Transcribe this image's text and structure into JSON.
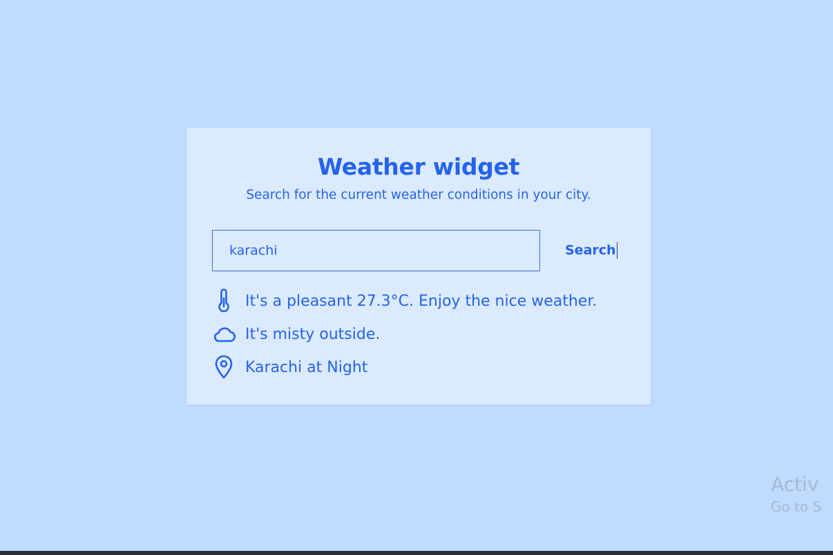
{
  "widget": {
    "title": "Weather widget",
    "subtitle": "Search for the current weather conditions in your city.",
    "search": {
      "value": "karachi",
      "placeholder": "",
      "button_label": "Search"
    },
    "results": {
      "temperature": {
        "icon": "thermometer-icon",
        "text": "It's a pleasant 27.3°C. Enjoy the nice weather."
      },
      "condition": {
        "icon": "cloud-icon",
        "text": "It's misty outside."
      },
      "location": {
        "icon": "map-pin-icon",
        "text": "Karachi at Night"
      }
    }
  },
  "watermark": {
    "line1": "Activ",
    "line2": "Go to S"
  },
  "colors": {
    "background": "#bfdbfe",
    "card": "#dbeafe",
    "accent": "#2563eb"
  }
}
